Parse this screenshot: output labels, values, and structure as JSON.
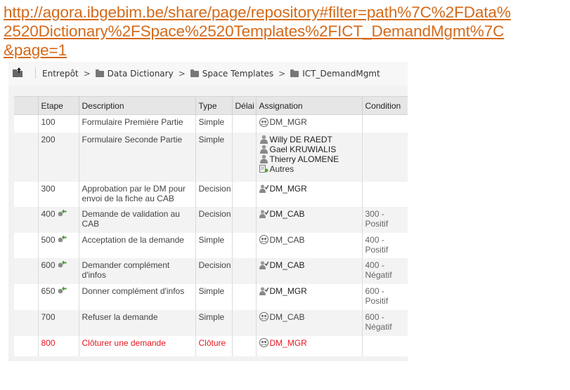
{
  "url": {
    "line1": "http://agora.ibgebim.be/share/page/repository#filter=path%7C%2FData%",
    "line2": "2520Dictionary%2FSpace%2520Templates%2FICT_DemandMgmt%7C",
    "line3": "&page=1"
  },
  "breadcrumb": [
    "Entrepôt",
    "Data Dictionary",
    "Space Templates",
    "ICT_DemandMgmt"
  ],
  "table": {
    "headers": [
      "Etape",
      "Description",
      "Type",
      "Délai",
      "Assignation",
      "Condition"
    ],
    "rows": [
      {
        "step": "100",
        "description": "Formulaire Première Partie",
        "type": "Simple",
        "assign": [
          "DM_MGR"
        ],
        "assign_icons": [
          "group-icon"
        ],
        "condition": ""
      },
      {
        "step": "200",
        "description": "Formulaire Seconde Partie",
        "type": "Simple",
        "assign": [
          "Willy DE RAEDT",
          "Gael KRUWIALIS",
          "Thierry ALOMENE",
          "Autres"
        ],
        "assign_icons": [
          "person-icon",
          "person-icon",
          "person-icon",
          "others-icon"
        ],
        "condition": ""
      },
      {
        "step": "300",
        "description": "Approbation par le DM pour envoi de la fiche au CAB",
        "type": "Decision",
        "assign": [
          "DM_MGR"
        ],
        "assign_icons": [
          "person-approve-icon"
        ],
        "condition": ""
      },
      {
        "step": "400",
        "description": "Demande de validation au CAB",
        "type": "Decision",
        "assign": [
          "DM_CAB"
        ],
        "assign_icons": [
          "person-approve-icon"
        ],
        "condition": "300 - Positif",
        "step_icon": "link-icon"
      },
      {
        "step": "500",
        "description": "Acceptation de la demande",
        "type": "Simple",
        "assign": [
          "DM_CAB"
        ],
        "assign_icons": [
          "group-icon"
        ],
        "condition": "400 - Positif",
        "step_icon": "link-icon"
      },
      {
        "step": "600",
        "description": "Demander complément d'infos",
        "type": "Decision",
        "assign": [
          "DM_CAB"
        ],
        "assign_icons": [
          "person-approve-icon"
        ],
        "condition": "400 - Négatif",
        "step_icon": "link-icon"
      },
      {
        "step": "650",
        "description": "Donner complément d'infos",
        "type": "Simple",
        "assign": [
          "DM_MGR"
        ],
        "assign_icons": [
          "person-approve-icon"
        ],
        "condition": "600 - Positif",
        "step_icon": "link-icon"
      },
      {
        "step": "700",
        "description": "Refuser la demande",
        "type": "Simple",
        "assign": [
          "DM_CAB"
        ],
        "assign_icons": [
          "group-icon"
        ],
        "condition": "600 - Négatif"
      },
      {
        "step": "800",
        "description": "Clôturer une demande",
        "type": "Clôture",
        "assign": [
          "DM_MGR"
        ],
        "assign_icons": [
          "group-icon"
        ],
        "condition": "",
        "highlight": "red"
      }
    ]
  },
  "colors": {
    "url": "#d46a1a",
    "closing_row": "#e8141c",
    "header_bg": "#e6e6e6"
  }
}
